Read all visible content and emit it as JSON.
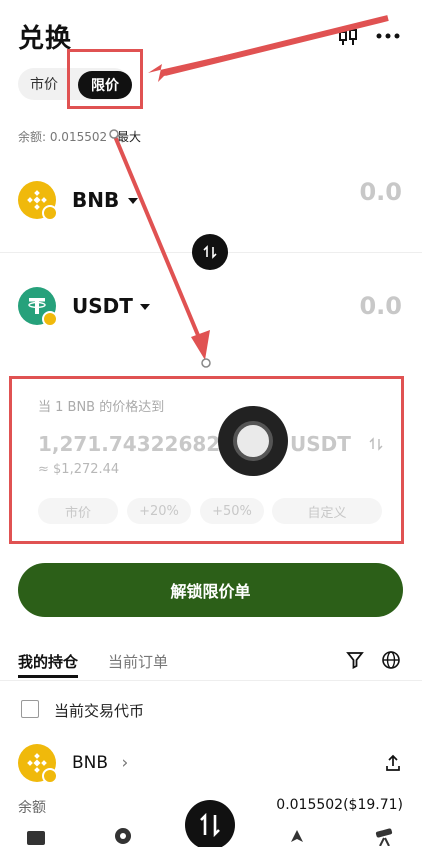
{
  "header": {
    "title": "兑换",
    "more_icon": "more-icon",
    "chart_icon": "candlestick-icon"
  },
  "mode_tabs": {
    "market": "市价",
    "limit": "限价"
  },
  "balance": {
    "label": "余额: 0.015502",
    "max": "最大"
  },
  "from_token": {
    "symbol": "BNB",
    "amount": "0.0"
  },
  "to_token": {
    "symbol": "USDT",
    "amount": "0.0"
  },
  "limit_price": {
    "label": "当 1 BNB 的价格达到",
    "price": "1,271.7432268246",
    "unit": "USDT",
    "approx": "≈ $1,272.44",
    "chips": [
      "市价",
      "+20%",
      "+50%",
      "自定义"
    ]
  },
  "unlock_button": "解锁限价单",
  "holdings_tabs": {
    "mine": "我的持仓",
    "orders": "当前订单"
  },
  "current_token_checkbox": "当前交易代币",
  "holding_row": {
    "symbol": "BNB",
    "arrow": "›",
    "balance_label": "余额",
    "balance_value": "0.015502($19.71)"
  },
  "colors": {
    "accent_green": "#2c5f18",
    "highlight_red": "#e05252",
    "bnb_yellow": "#f0b90b",
    "usdt_green": "#26a17b"
  }
}
